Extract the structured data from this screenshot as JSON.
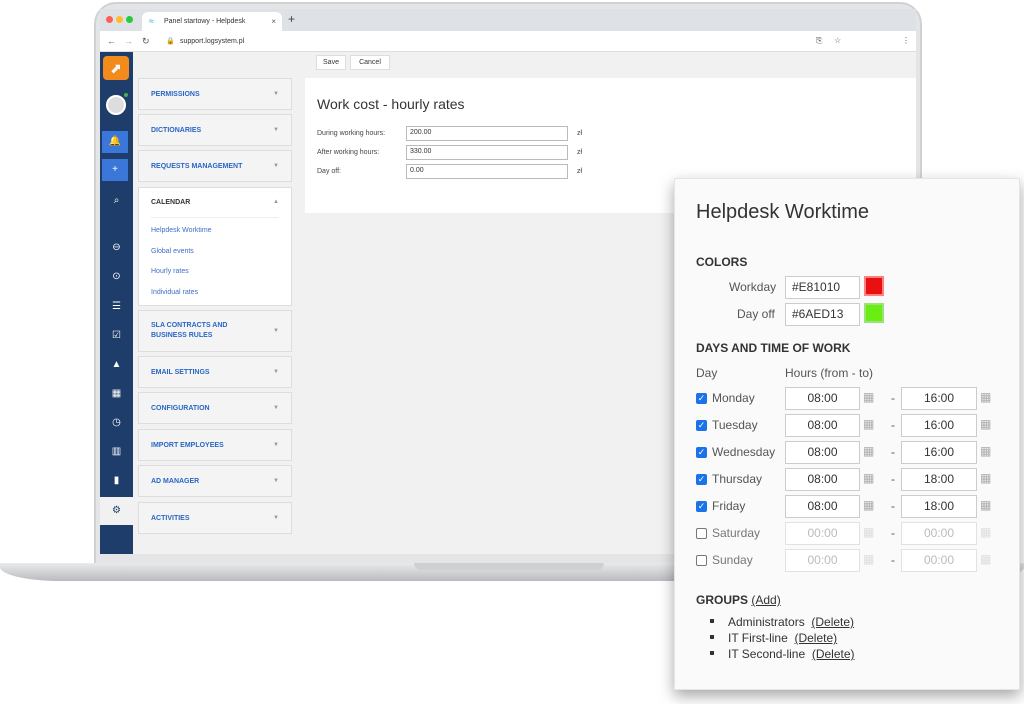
{
  "browser": {
    "tab_title": "Panel startowy - Helpdesk",
    "url": "support.logsystem.pl"
  },
  "toolbar": {
    "save": "Save",
    "cancel": "Cancel"
  },
  "menu": [
    {
      "label": "PERMISSIONS"
    },
    {
      "label": "DICTIONARIES"
    },
    {
      "label": "REQUESTS MANAGEMENT"
    },
    {
      "label": "CALENDAR",
      "expanded": true,
      "items": [
        "Helpdesk Worktime",
        "Global events",
        "Hourly rates",
        "Individual rates"
      ]
    },
    {
      "label": "SLA CONTRACTS AND BUSINESS RULES"
    },
    {
      "label": "EMAIL SETTINGS"
    },
    {
      "label": "CONFIGURATION"
    },
    {
      "label": "IMPORT EMPLOYEES"
    },
    {
      "label": "AD MANAGER"
    },
    {
      "label": "ACTIVITIES"
    }
  ],
  "work_cost": {
    "title": "Work cost - hourly rates",
    "currency": "zł",
    "rows": [
      {
        "label": "During working hours:",
        "value": "200.00"
      },
      {
        "label": "After working hours:",
        "value": "330.00"
      },
      {
        "label": "Day off:",
        "value": "0.00"
      }
    ]
  },
  "worktime": {
    "title": "Helpdesk Worktime",
    "colors_heading": "COLORS",
    "colors": [
      {
        "label": "Workday",
        "value": "#E81010",
        "swatch": "#E81010"
      },
      {
        "label": "Day off",
        "value": "#6AED13",
        "swatch": "#6AED13"
      }
    ],
    "days_heading": "DAYS AND TIME OF WORK",
    "col_day": "Day",
    "col_hours": "Hours (from - to)",
    "separator": "-",
    "days": [
      {
        "name": "Monday",
        "checked": true,
        "from": "08:00",
        "to": "16:00"
      },
      {
        "name": "Tuesday",
        "checked": true,
        "from": "08:00",
        "to": "16:00"
      },
      {
        "name": "Wednesday",
        "checked": true,
        "from": "08:00",
        "to": "16:00"
      },
      {
        "name": "Thursday",
        "checked": true,
        "from": "08:00",
        "to": "18:00"
      },
      {
        "name": "Friday",
        "checked": true,
        "from": "08:00",
        "to": "18:00"
      },
      {
        "name": "Saturday",
        "checked": false,
        "from": "00:00",
        "to": "00:00"
      },
      {
        "name": "Sunday",
        "checked": false,
        "from": "00:00",
        "to": "00:00"
      }
    ],
    "groups_heading": "GROUPS",
    "add": "(Add)",
    "delete": "(Delete)",
    "groups": [
      "Administrators",
      "IT First-line",
      "IT Second-line"
    ]
  }
}
